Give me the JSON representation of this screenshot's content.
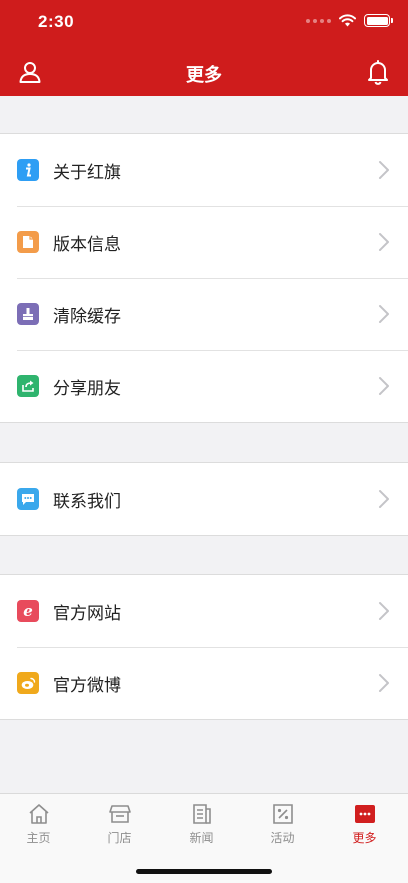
{
  "status_bar": {
    "time": "2:30"
  },
  "nav": {
    "title": "更多",
    "user_icon": "user-icon",
    "bell_icon": "bell-icon"
  },
  "groups": [
    [
      {
        "label": "关于红旗",
        "icon": "info-icon",
        "color": "#2e9ef4"
      },
      {
        "label": "版本信息",
        "icon": "document-icon",
        "color": "#f39c4a"
      },
      {
        "label": "清除缓存",
        "icon": "brush-icon",
        "color": "#7c6eb6"
      },
      {
        "label": "分享朋友",
        "icon": "share-icon",
        "color": "#2fb46e"
      }
    ],
    [
      {
        "label": "联系我们",
        "icon": "chat-icon",
        "color": "#3aa8ec"
      }
    ],
    [
      {
        "label": "官方网站",
        "icon": "browser-e-icon",
        "color": "#e84b5c"
      },
      {
        "label": "官方微博",
        "icon": "weibo-icon",
        "color": "#f0a91c"
      }
    ]
  ],
  "tabbar": {
    "items": [
      {
        "label": "主页",
        "icon": "home-icon"
      },
      {
        "label": "门店",
        "icon": "store-icon"
      },
      {
        "label": "新闻",
        "icon": "news-icon"
      },
      {
        "label": "活动",
        "icon": "percent-tag-icon"
      },
      {
        "label": "更多",
        "icon": "more-icon"
      }
    ],
    "active_index": 4,
    "active_color": "#d11f1f"
  }
}
